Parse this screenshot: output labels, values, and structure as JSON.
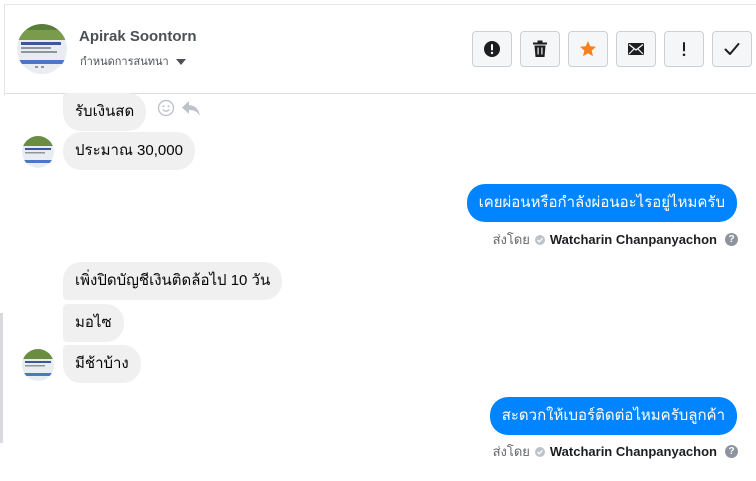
{
  "contact": {
    "name": "Apirak Soontorn",
    "subtitle": "กำหนดการสนทนา"
  },
  "toolbar": {
    "buttons": [
      {
        "icon": "alert-circle-icon",
        "label": "Mark as spam"
      },
      {
        "icon": "trash-icon",
        "label": "Delete"
      },
      {
        "icon": "star-icon",
        "label": "Star"
      },
      {
        "icon": "envelope-icon",
        "label": "Mark as unread"
      },
      {
        "icon": "exclamation-icon",
        "label": "Follow up"
      },
      {
        "icon": "checkmark-icon",
        "label": "Mark as done"
      }
    ]
  },
  "messages": [
    {
      "direction": "in",
      "text": "รับเงินสด"
    },
    {
      "direction": "in",
      "text": "ประมาณ 30,000"
    },
    {
      "direction": "out",
      "text": "เคยผ่อนหรือกำลังผ่อนอะไรอยู่ไหมครับ"
    },
    {
      "direction": "in",
      "text": "เพิ่งปิดบัญชีเงินติดล้อไป 10 วัน"
    },
    {
      "direction": "in",
      "text": "มอไซ"
    },
    {
      "direction": "in",
      "text": "มีช้าบ้าง"
    },
    {
      "direction": "out",
      "text": "สะดวกให้เบอร์ติดต่อไหมครับลูกค้า"
    }
  ],
  "sent_by": {
    "label": "ส่งโดย",
    "agent": "Watcharin Chanpanyachon",
    "help": "?"
  },
  "colors": {
    "outgoing_bubble": "#0084ff",
    "incoming_bubble": "#f0f0f0",
    "star": "#f5821f"
  }
}
